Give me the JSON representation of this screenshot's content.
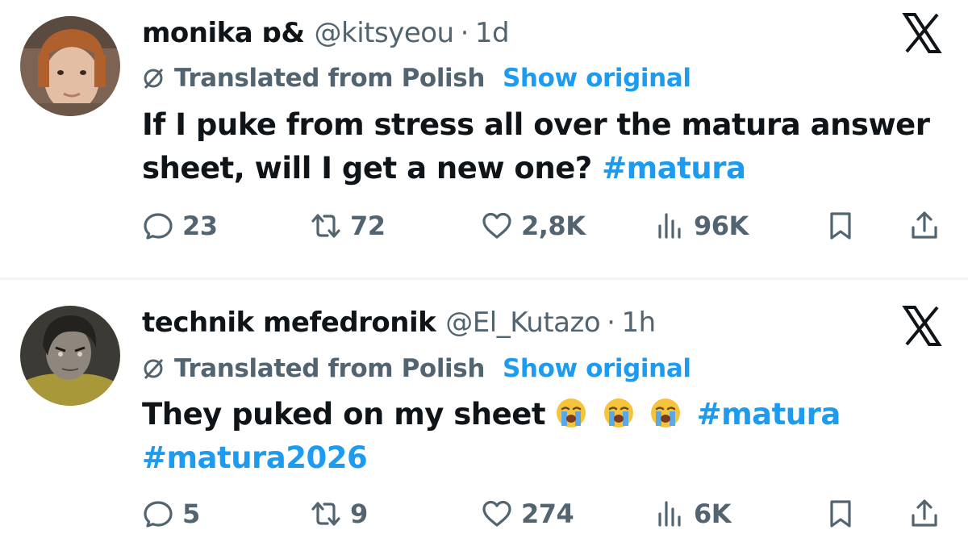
{
  "tweets": [
    {
      "author_name": "monika ɒ&",
      "author_handle": "@kitsyeou",
      "separator": "·",
      "time": "1d",
      "translated_label": "Translated from Polish",
      "show_original_label": "Show original",
      "text": "If I puke from stress all over the matura answer sheet, will I get a new one?",
      "hashtags": [
        "#matura"
      ],
      "stats": {
        "replies": "23",
        "retweets": "72",
        "likes": "2,8K",
        "views": "96K"
      },
      "avatar_colors": {
        "bg": "#8a6a55",
        "hair": "#b5652e",
        "skin": "#e6c2a8"
      }
    },
    {
      "author_name": "technik mefedronik",
      "author_handle": "@El_Kutazo",
      "separator": "·",
      "time": "1h",
      "translated_label": "Translated from Polish",
      "show_original_label": "Show original",
      "text": "They puked on my sheet",
      "emoji_count": 3,
      "emoji_name": "loudly-crying-face",
      "hashtags": [
        "#matura",
        "#matura2026"
      ],
      "stats": {
        "replies": "5",
        "retweets": "9",
        "likes": "274",
        "views": "6K"
      },
      "avatar_colors": {
        "bg": "#3e3d36",
        "hair": "#2a2824",
        "skin": "#9a938a",
        "shirt": "#b1a13c"
      }
    }
  ],
  "icons": {
    "close": "x-logo-icon",
    "translate": "translate-icon",
    "reply": "reply-icon",
    "retweet": "retweet-icon",
    "like": "heart-icon",
    "views": "views-icon",
    "bookmark": "bookmark-icon",
    "share": "share-icon"
  },
  "colors": {
    "accent": "#1d9bf0",
    "muted": "#536471",
    "text": "#0f1419",
    "divider": "#eff3f4"
  }
}
